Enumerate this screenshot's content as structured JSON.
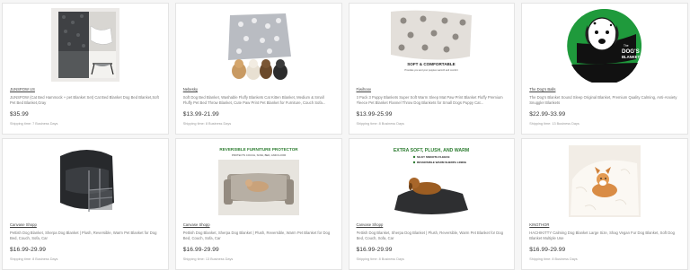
{
  "products": [
    {
      "seller": "JUNSPOW US",
      "title": "JUNSPOW (Cat Bed Hammock + pet Blanket Set) Cat Bed Blanket Dog Bed Blanket,Soft Pet Bed Blanket,Gray",
      "price": "$35.99",
      "shipping": "Shipping time: 7 Business Days",
      "image": "hammock-photo"
    },
    {
      "seller": "Nebesky",
      "title": "Soft Dog Bed Blanket, Washable Fluffy Blankets Cat Kitten Blanket, Medium & Small Fluffy Pet Bed Throw Blanket, Cute Paw Print Pet Blanket for Furniture, Couch Sofa...",
      "price": "$13.99-21.99",
      "shipping": "Shipping time: 8 Business Days",
      "image": "paw-blanket-photo"
    },
    {
      "seller": "Fiwihoov",
      "title": "3 Pack 3 Puppy Blankets Super Soft Warm Sleep Mat Paw Print Blanket Fluffy Premium Fleece Pet Blanket Flannel Throw Dog Blankets for Small Dogs Puppy Cat...",
      "price": "$13.99-25.99",
      "shipping": "Shipping time: 8 Business Days",
      "image": "paw-mat-photo",
      "image_text": [
        "SOFT & COMFORTABLE",
        "Provides you and your puppies warmth and comfort"
      ]
    },
    {
      "seller": "The Dog's Balls",
      "title": "The Dog's Blanket Sound Sleep Original Blanket, Premium Quality Calming, Anti-Anxiety Snuggler Blankets",
      "price": "$22.99-33.99",
      "shipping": "Shipping time: 13 Business Days",
      "image": "dogs-blanket-logo",
      "image_text": [
        "The",
        "DOG'S",
        "BLANKET"
      ]
    },
    {
      "seller": "Canvase Shopp",
      "title": "Pettish Dog Blanket, Sherpa Dog Blanket | Plush, Reversible, Warm Pet Blanket for Dog Bed, Couch, Sofa, Car",
      "price": "$16.99-29.99",
      "shipping": "Shipping time: 8 Business Days",
      "image": "folded-plaid-photo"
    },
    {
      "seller": "Canvase Shopp",
      "title": "Pettish Dog Blanket, Sherpa Dog Blanket | Plush, Reversible, Warm Pet Blanket for Dog Bed, Couch, Sofa, Car",
      "price": "$16.99-29.99",
      "shipping": "Shipping time: 13 Business Days",
      "image": "sofa-protector-photo",
      "image_text": [
        "REVERSIBLE FURNITURE PROTECTOR",
        "PROTECTS COUCH, SOFA, BED, AND FLOOR"
      ]
    },
    {
      "seller": "Canvase Shopp",
      "title": "Pettish Dog Blanket, Sherpa Dog Blanket | Plush, Reversible, Warm Pet Blanket for Dog Bed, Couch, Sofa, Car",
      "price": "$16.99-29.99",
      "shipping": "Shipping time: 8 Business Days",
      "image": "plush-warm-photo",
      "image_text": [
        "EXTRA SOFT, PLUSH, AND WARM",
        "SILKY SMOOTH FLEECE",
        "REVERSIBLE WARM SHERPA LINING"
      ]
    },
    {
      "seller": "KINGTHOR",
      "title": "HACHIKITTY Calming Dog Blanket Large Size, Shag Vegan Fur Dog Blanket, Soft Dog Blanket Multiple Use",
      "price": "$16.99-29.99",
      "shipping": "Shipping time: 8 Business Days",
      "image": "corgi-fur-photo"
    }
  ],
  "colors": {
    "logo_green": "#1f9a3c",
    "headline_green": "#2e7d32",
    "price_text": "#333333"
  }
}
